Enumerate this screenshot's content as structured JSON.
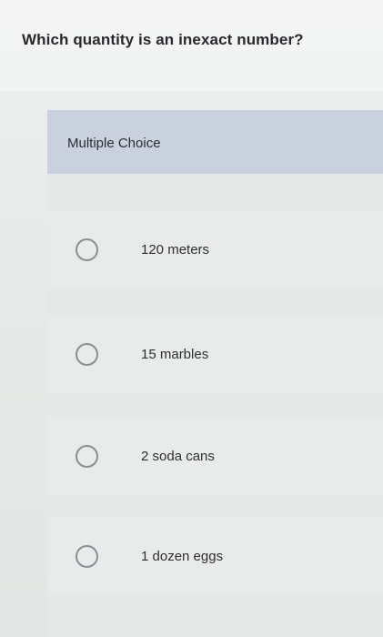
{
  "question": {
    "text": "Which quantity is an inexact number?"
  },
  "section": {
    "header_label": "Multiple Choice"
  },
  "options": [
    {
      "label": "120 meters"
    },
    {
      "label": "15 marbles"
    },
    {
      "label": "2 soda cans"
    },
    {
      "label": "1 dozen eggs"
    }
  ],
  "icons": {
    "radio": "radio-unselected-icon"
  },
  "colors": {
    "header_bg": "#c9d1df",
    "page_bg": "#e6e8e6",
    "text": "#2a2a2e",
    "radio_border": "#8a8f97"
  }
}
